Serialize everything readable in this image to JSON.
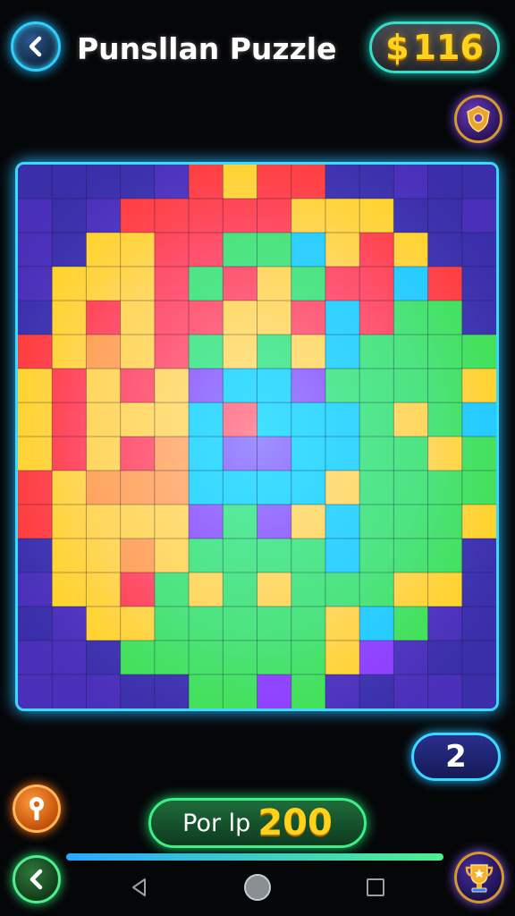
{
  "header": {
    "title": "Punsllan Puzzle",
    "coins": {
      "symbol": "$",
      "value": "116"
    }
  },
  "level": {
    "value": "2"
  },
  "score": {
    "label": "Por lp",
    "value": "200"
  },
  "progress": {
    "fraction": 1.0
  },
  "icons": {
    "back": "chevron-left-icon",
    "badge": "shield-badge-icon",
    "key": "key-icon",
    "trophy": "trophy-icon",
    "nav_back": "triangle-back-icon",
    "nav_home": "circle-home-icon",
    "nav_recents": "square-recents-icon"
  },
  "colors": {
    "accent_cyan": "#3ad9ff",
    "coin_gold": "#ffd21c",
    "score_green": "#3bf08a"
  }
}
